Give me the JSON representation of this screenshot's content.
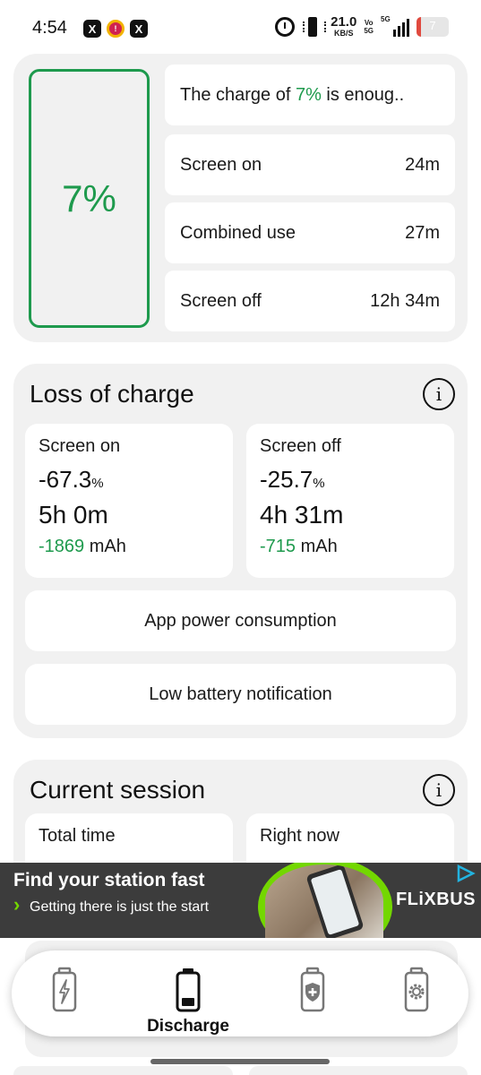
{
  "status_bar": {
    "time": "4:54",
    "notification_icons": [
      "X",
      "!",
      "X"
    ],
    "net_speed_value": "21.0",
    "net_speed_unit": "KB/S",
    "volte_top": "Vo",
    "volte_bottom": "5G",
    "network_type": "5G",
    "battery_level": "7"
  },
  "summary": {
    "charge_percent": "7%",
    "message_prefix": "The charge of ",
    "message_value": "7%",
    "message_suffix": " is enoug..",
    "rows": [
      {
        "label": "Screen on",
        "value": "24m"
      },
      {
        "label": "Combined use",
        "value": "27m"
      },
      {
        "label": "Screen off",
        "value": "12h 34m"
      }
    ]
  },
  "loss": {
    "title": "Loss of charge",
    "info": "i",
    "screen_on": {
      "label": "Screen on",
      "percent": "-67.3",
      "percent_unit": "%",
      "duration": "5h 0m",
      "mah_value": "-1869",
      "mah_unit": " mAh"
    },
    "screen_off": {
      "label": "Screen off",
      "percent": "-25.7",
      "percent_unit": "%",
      "duration": "4h 31m",
      "mah_value": "-715",
      "mah_unit": " mAh"
    },
    "app_power_button": "App power consumption",
    "low_battery_button": "Low battery notification"
  },
  "session": {
    "title": "Current session",
    "info": "i",
    "total_time_label": "Total time",
    "right_now_label": "Right now"
  },
  "ad": {
    "title": "Find your station fast",
    "subtitle": "Getting there is just the start",
    "brand": "FLiXBUS",
    "accent_color": "#73d700"
  },
  "bottom_nav": {
    "items": [
      {
        "icon": "battery-charge-icon",
        "label": ""
      },
      {
        "icon": "battery-discharge-icon",
        "label": "Discharge"
      },
      {
        "icon": "battery-health-icon",
        "label": ""
      },
      {
        "icon": "battery-settings-icon",
        "label": ""
      }
    ],
    "active": 1
  },
  "colors": {
    "accent_green": "#1e9a4d",
    "card_bg": "#f1f1f1"
  }
}
